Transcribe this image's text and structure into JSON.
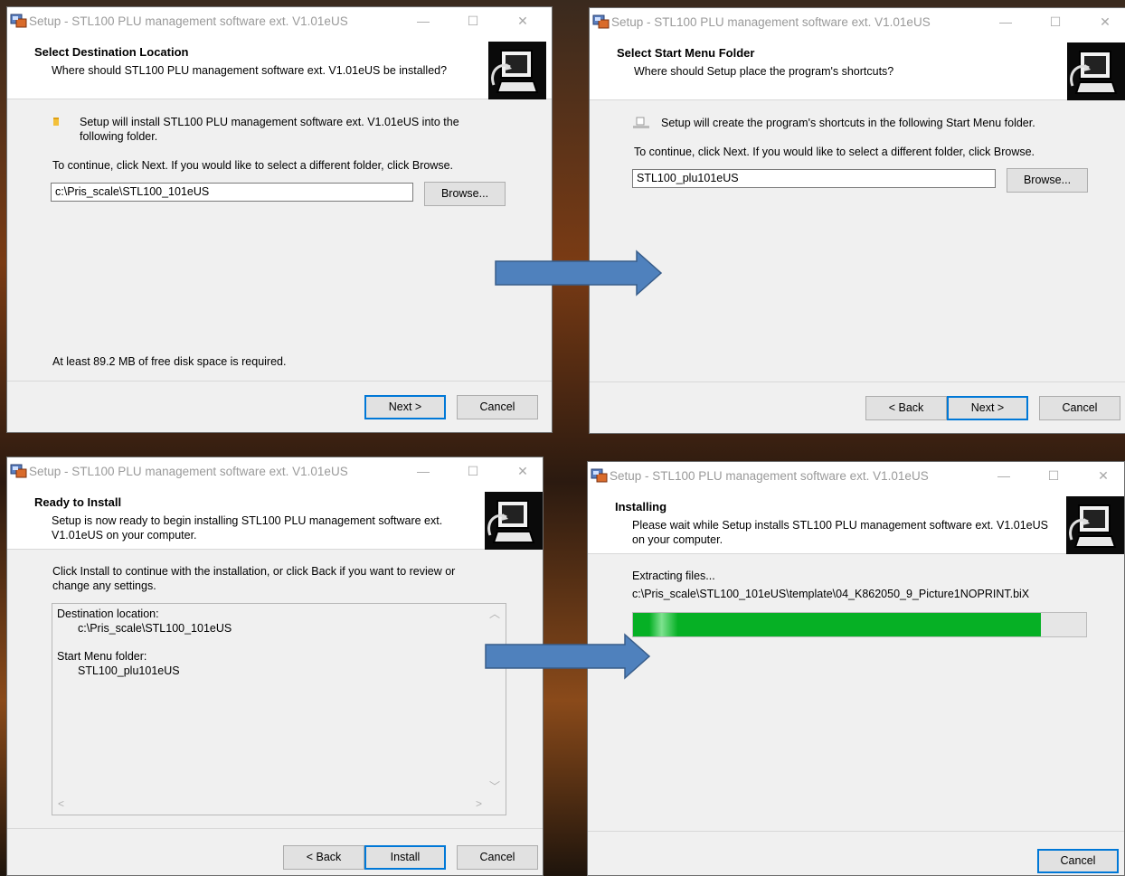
{
  "app_title": "Setup - STL100 PLU management software ext.  V1.01eUS",
  "colors": {
    "accent": "#0078d7",
    "progress_green": "#06b025",
    "arrow_fill": "#4f81bd",
    "arrow_stroke": "#385d8a"
  },
  "dialogs": {
    "destination": {
      "title": "Select Destination Location",
      "subtitle": "Where should STL100 PLU management software ext.  V1.01eUS be installed?",
      "info": "Setup will install STL100 PLU management software ext.  V1.01eUS into the following folder.",
      "instruction": "To continue, click Next. If you would like to select a different folder, click Browse.",
      "path_value": "c:\\Pris_scale\\STL100_101eUS",
      "browse_label": "Browse...",
      "disk_space": "At least 89.2 MB of free disk space is required.",
      "next_label": "Next >",
      "cancel_label": "Cancel"
    },
    "start_menu": {
      "title": "Select Start Menu Folder",
      "subtitle": "Where should Setup place the program's shortcuts?",
      "info": "Setup will create the program's shortcuts in the following Start Menu folder.",
      "instruction": "To continue, click Next. If you would like to select a different folder, click Browse.",
      "folder_value": "STL100_plu101eUS",
      "browse_label": "Browse...",
      "back_label": "< Back",
      "next_label": "Next >",
      "cancel_label": "Cancel"
    },
    "ready": {
      "title": "Ready to Install",
      "subtitle": "Setup is now ready to begin installing STL100 PLU management software ext.  V1.01eUS on your computer.",
      "instruction": "Click Install to continue with the installation, or click Back if you want to review or change any settings.",
      "dest_label": "Destination location:",
      "dest_value": "c:\\Pris_scale\\STL100_101eUS",
      "menu_label": "Start Menu folder:",
      "menu_value": "STL100_plu101eUS",
      "back_label": "< Back",
      "install_label": "Install",
      "cancel_label": "Cancel"
    },
    "installing": {
      "title": "Installing",
      "subtitle": "Please wait while Setup installs STL100 PLU management software ext.  V1.01eUS on your computer.",
      "status": "Extracting files...",
      "current_file": "c:\\Pris_scale\\STL100_101eUS\\template\\04_K862050_9_Picture1NOPRINT.biX",
      "progress_percent": 90,
      "cancel_label": "Cancel"
    }
  },
  "icons": {
    "app": "setup-app-icon",
    "header": "computer-install-icon",
    "folder": "folder-icon",
    "shortcut": "start-menu-folder-icon",
    "minimize": "minimize-icon",
    "maximize": "maximize-icon",
    "close": "close-icon",
    "arrow": "right-arrow-icon"
  }
}
